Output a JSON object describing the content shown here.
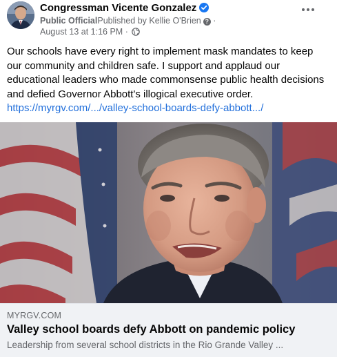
{
  "post": {
    "author": "Congressman Vicente Gonzalez",
    "category": "Public Official",
    "published_by": "Published by Kellie O'Brien",
    "separator": "·",
    "timestamp": "August 13 at 1:16 PM",
    "privacy_icon": "globe-icon",
    "verified_icon": "verified-badge-icon",
    "body": "Our schools have every right to implement mask mandates to keep our community and children safe. I support and applaud our educational leaders who made commonsense public health decisions and defied Governor Abbott's illogical executive order.",
    "link": "https://myrgv.com/.../valley-school-boards-defy-abbott.../",
    "link_color": "#216fdb"
  },
  "link_preview": {
    "domain": "MYRGV.COM",
    "headline": "Valley school boards defy Abbott on pandemic policy",
    "description": "Leadership from several school districts in the Rio Grande Valley ...",
    "background_color": "#f0f2f5"
  }
}
